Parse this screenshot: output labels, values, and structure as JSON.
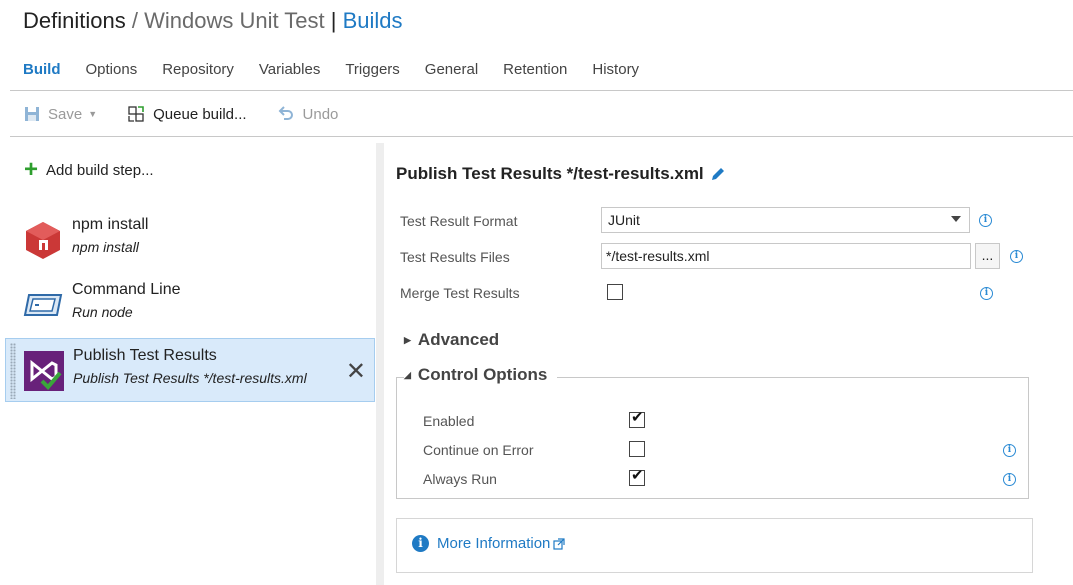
{
  "header": {
    "breadcrumb_root": "Definitions",
    "separator": "/",
    "definition_name": "Windows Unit Test",
    "pipe": "|",
    "section": "Builds"
  },
  "tabs": [
    {
      "label": "Build",
      "active": true
    },
    {
      "label": "Options"
    },
    {
      "label": "Repository"
    },
    {
      "label": "Variables"
    },
    {
      "label": "Triggers"
    },
    {
      "label": "General"
    },
    {
      "label": "Retention"
    },
    {
      "label": "History"
    }
  ],
  "toolbar": {
    "save_label": "Save",
    "queue_label": "Queue build...",
    "undo_label": "Undo"
  },
  "steps_pane": {
    "add_label": "Add build step...",
    "steps": [
      {
        "name": "npm install",
        "sub": "npm install",
        "icon": "npm-icon"
      },
      {
        "name": "Command Line",
        "sub": "Run node",
        "icon": "command-line-icon"
      },
      {
        "name": "Publish Test Results",
        "sub": "Publish Test Results */test-results.xml",
        "icon": "visual-studio-test-icon",
        "selected": true
      }
    ]
  },
  "task": {
    "title": "Publish Test Results */test-results.xml",
    "fields": {
      "format_label": "Test Result Format",
      "format_value": "JUnit",
      "files_label": "Test Results Files",
      "files_value": "*/test-results.xml",
      "browse_label": "...",
      "merge_label": "Merge Test Results",
      "merge_checked": false
    },
    "advanced_label": "Advanced",
    "control_options": {
      "label": "Control Options",
      "enabled_label": "Enabled",
      "enabled_checked": true,
      "continue_label": "Continue on Error",
      "continue_checked": false,
      "always_label": "Always Run",
      "always_checked": true
    },
    "more_info_label": "More Information"
  },
  "colors": {
    "accent": "#1f7ac4",
    "selected_bg": "#d9eafa",
    "add_green": "#2e9e2e",
    "npm_red": "#cb3837",
    "vs_purple": "#68217a"
  }
}
